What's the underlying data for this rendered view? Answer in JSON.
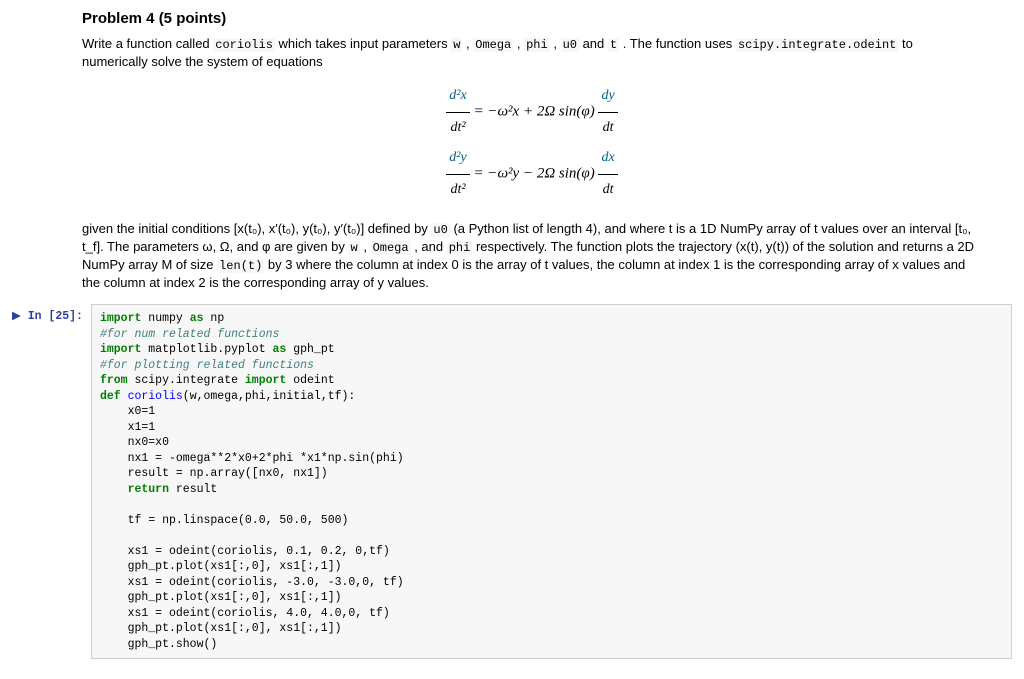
{
  "heading": "Problem 4 (5 points)",
  "intro": {
    "pre": "Write a function called ",
    "fn": "coriolis",
    "mid1": " which takes input parameters ",
    "p_w": "w",
    "c": " , ",
    "p_omega": "Omega",
    "p_phi": "phi",
    "p_u0": "u0",
    "and": " and ",
    "p_t": "t",
    "mid2": " . The function uses ",
    "odeint": "scipy.integrate.odeint",
    "mid3": " to numerically solve the system of equations"
  },
  "equations": {
    "eq1_lhs_num": "d²x",
    "eq1_lhs_den": "dt²",
    "eq1_rhs_a": "= −ω²x + 2Ω sin(φ)",
    "eq1_rhs_num": "dy",
    "eq1_rhs_den": "dt",
    "eq2_lhs_num": "d²y",
    "eq2_lhs_den": "dt²",
    "eq2_rhs_a": "= −ω²y − 2Ω sin(φ)",
    "eq2_rhs_num": "dx",
    "eq2_rhs_den": "dt"
  },
  "para2": {
    "a": "given the initial conditions [x(t₀), x′(t₀), y(t₀), y′(t₀)] defined by ",
    "u0": "u0",
    "b": "  (a Python list of length 4), and where t is a 1D NumPy array of t values over an interval [t₀, t_f]. The parameters ω, Ω, and φ are given by ",
    "w": "w",
    "c1": " , ",
    "omega": "Omega",
    "c2": " , and ",
    "phi": "phi",
    "d": " respectively. The function plots the trajectory (x(t), y(t)) of the solution and returns a 2D NumPy array M of size ",
    "lent": "len(t)",
    "e": " by 3 where the column at index 0 is the array of t values, the column at index 1 is the corresponding array of x values and the column at index 2 is the corresponding array of y values."
  },
  "cell": {
    "prompt": "In [25]:",
    "l1_a": "import",
    "l1_b": " numpy ",
    "l1_c": "as",
    "l1_d": " np",
    "l2": "#for num related functions",
    "l3_a": "import",
    "l3_b": " matplotlib.pyplot ",
    "l3_c": "as",
    "l3_d": " gph_pt",
    "l4": "#for plotting related functions",
    "l5_a": "from",
    "l5_b": " scipy.integrate ",
    "l5_c": "import",
    "l5_d": " odeint",
    "l6_a": "def ",
    "l6_b": "coriolis",
    "l6_c": "(w,omega,phi,initial,tf):",
    "l7": "    x0=1",
    "l8": "    x1=1",
    "l9": "    nx0=x0",
    "l10": "    nx1 = -omega**2*x0+2*phi *x1*np.sin(phi)",
    "l11": "    result = np.array([nx0, nx1])",
    "l12_a": "    ",
    "l12_b": "return",
    "l12_c": " result",
    "l13": "",
    "l14": "    tf = np.linspace(0.0, 50.0, 500)",
    "l15": "",
    "l16": "    xs1 = odeint(coriolis, 0.1, 0.2, 0,tf)",
    "l17": "    gph_pt.plot(xs1[:,0], xs1[:,1])",
    "l18": "    xs1 = odeint(coriolis, -3.0, -3.0,0, tf)",
    "l19": "    gph_pt.plot(xs1[:,0], xs1[:,1])",
    "l20": "    xs1 = odeint(coriolis, 4.0, 4.0,0, tf)",
    "l21": "    gph_pt.plot(xs1[:,0], xs1[:,1])",
    "l22": "    gph_pt.show()"
  }
}
